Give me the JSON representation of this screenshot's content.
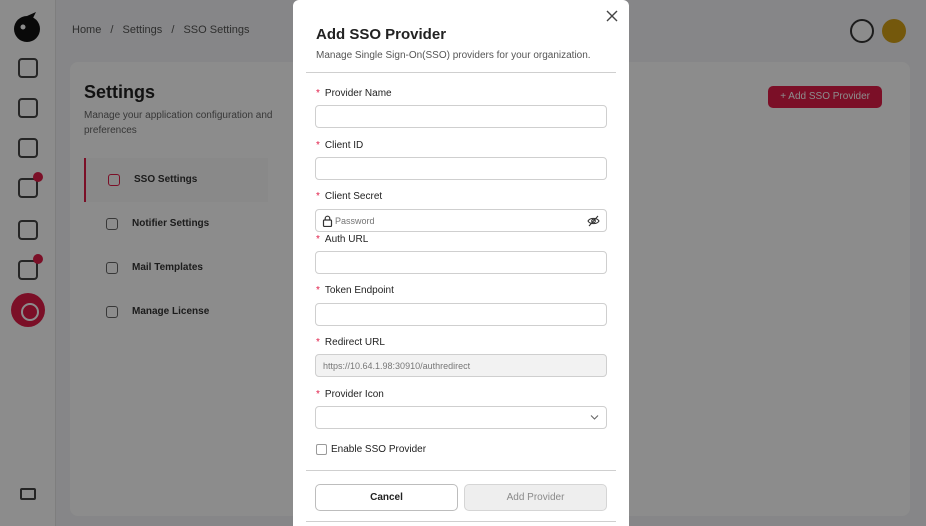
{
  "background": {
    "breadcrumb": [
      "Home",
      "/",
      "Settings",
      "/",
      "SSO Settings"
    ],
    "page_title": "Settings",
    "page_subtitle": "Manage your application configuration and preferences",
    "add_button": "+ Add SSO Provider",
    "menu": [
      {
        "label": "SSO Settings",
        "icon": "shield-icon"
      },
      {
        "label": "Notifier Settings",
        "icon": "bell-icon"
      },
      {
        "label": "Mail Templates",
        "icon": "mail-icon"
      },
      {
        "label": "Manage License",
        "icon": "key-icon"
      }
    ],
    "accent_color": "#e11d48"
  },
  "modal": {
    "title": "Add SSO Provider",
    "description": "Manage Single Sign-On(SSO) providers for your organization.",
    "required_marker": "*",
    "fields": {
      "provider_name": {
        "label": "Provider Name",
        "value": ""
      },
      "client_id": {
        "label": "Client ID",
        "value": ""
      },
      "client_secret": {
        "label": "Client Secret",
        "placeholder": "Password",
        "value": ""
      },
      "auth_url": {
        "label": "Auth URL",
        "value": ""
      },
      "token_endpoint": {
        "label": "Token Endpoint",
        "value": ""
      },
      "redirect_url": {
        "label": "Redirect URL",
        "value": "https://10.64.1.98:30910/authredirect"
      },
      "provider_icon": {
        "label": "Provider Icon",
        "value": ""
      }
    },
    "enable_checkbox": {
      "label": "Enable SSO Provider",
      "checked": false
    },
    "cancel_label": "Cancel",
    "submit_label": "Add Provider"
  }
}
